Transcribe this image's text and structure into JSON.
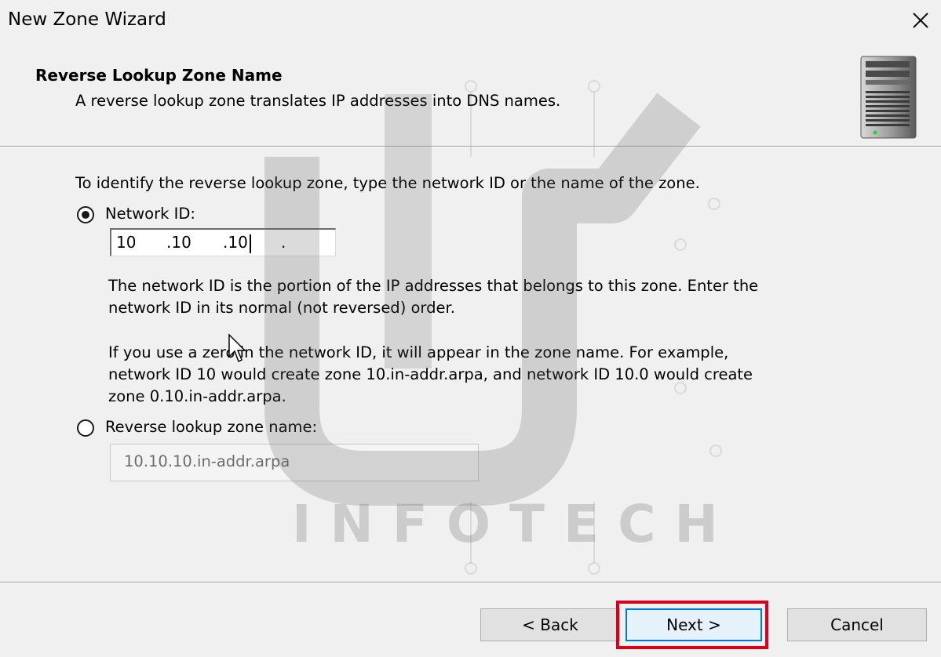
{
  "window": {
    "title": "New Zone Wizard",
    "close_icon": "close-icon"
  },
  "header": {
    "title": "Reverse Lookup Zone Name",
    "subtitle": "A reverse lookup zone translates IP addresses into DNS names.",
    "icon": "server-icon"
  },
  "content": {
    "instruction": "To identify the reverse lookup zone, type the network ID or the name of the zone.",
    "network_id": {
      "label": "Network ID:",
      "selected": true,
      "octets": [
        "10",
        ".10",
        ".10",
        "."
      ],
      "help_1_line1": "The network ID is the portion of the IP addresses that belongs to this zone. Enter the",
      "help_1_line2": "network ID in its normal (not reversed) order.",
      "help_2_line1": "If you use a zero in the network ID, it will appear in the zone name. For example,",
      "help_2_line2": "network ID 10 would create zone 10.in-addr.arpa, and network ID 10.0 would create",
      "help_2_line3": "zone 0.10.in-addr.arpa."
    },
    "zone_name": {
      "label": "Reverse lookup zone name:",
      "selected": false,
      "value": "10.10.10.in-addr.arpa"
    }
  },
  "buttons": {
    "back": "< Back",
    "next": "Next >",
    "cancel": "Cancel"
  },
  "watermark": {
    "text": "INFOTECH"
  },
  "colors": {
    "highlight": "#d9001b",
    "focus": "#0078d7"
  }
}
